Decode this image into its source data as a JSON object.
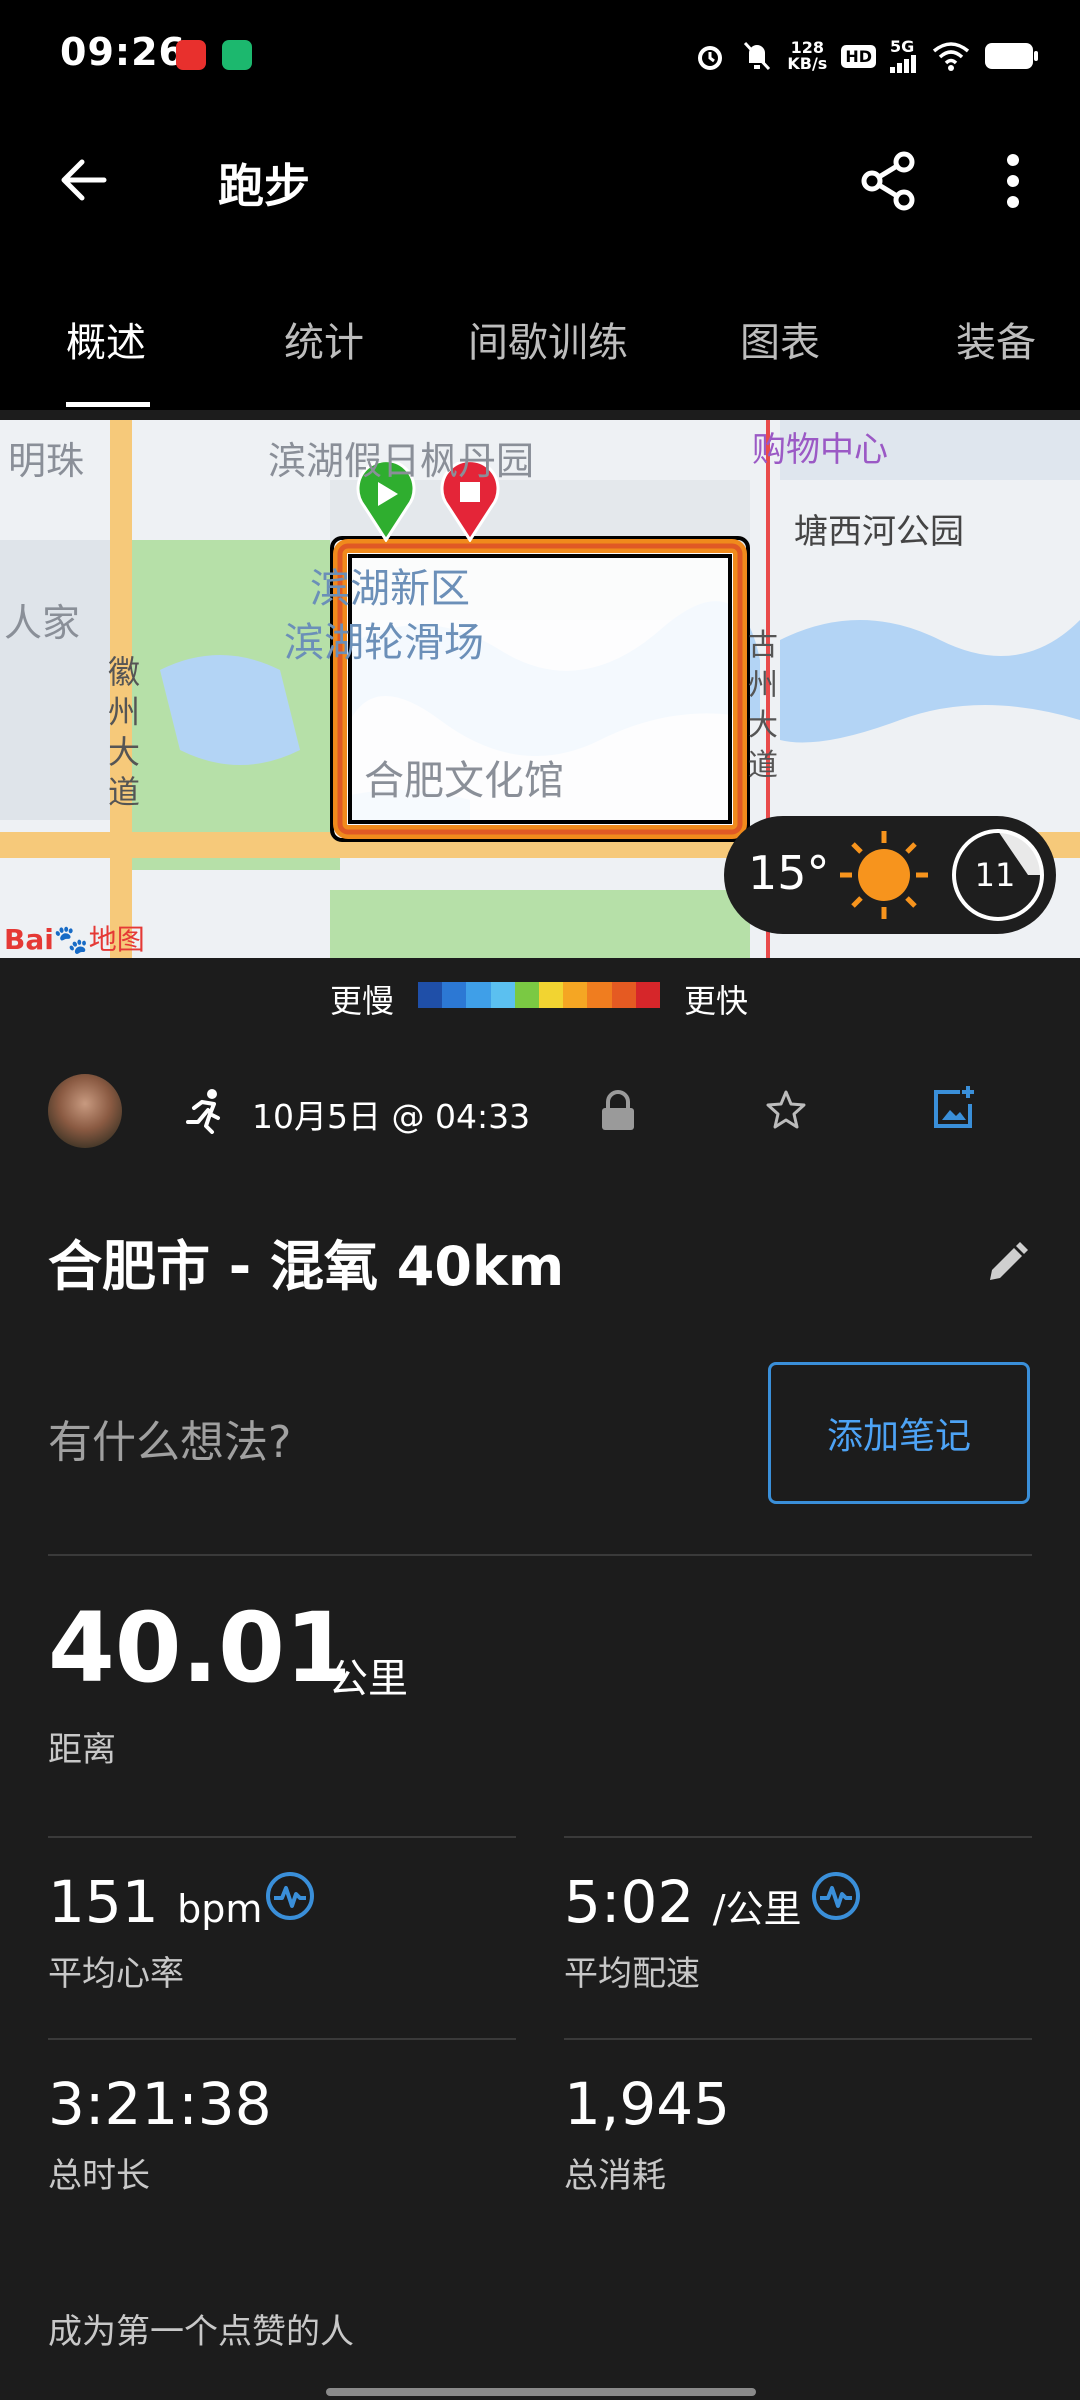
{
  "status_bar": {
    "time": "09:26",
    "net_speed_top": "128",
    "net_speed_bottom": "KB/s",
    "hd": "HD",
    "network": "5G"
  },
  "app_bar": {
    "title": "跑步",
    "back_icon": "arrow-left-icon",
    "share_icon": "share-icon",
    "more_icon": "more-vertical-icon"
  },
  "tabs": [
    {
      "label": "概述",
      "active": true
    },
    {
      "label": "统计",
      "active": false
    },
    {
      "label": "间歇训练",
      "active": false
    },
    {
      "label": "图表",
      "active": false
    },
    {
      "label": "装备",
      "active": false
    }
  ],
  "map": {
    "labels": {
      "mingzhu": "明珠",
      "binhu_jiari": "滨湖假日枫丹园",
      "gouwu": "购物中心",
      "tangxihe": "塘西河公园",
      "renjia": "人家",
      "binhu_xinqu": "滨湖新区",
      "binhu_lunhua": "滨湖轮滑场",
      "huizhou": "徽州大道",
      "wenhua": "合肥文化馆",
      "guzhou": "古州大道",
      "baidu": "Bai",
      "baidu_map": "地图"
    },
    "weather": {
      "temp": "15°",
      "wind": "11"
    },
    "colors": {
      "route_outer": "#f08a1c",
      "route_inner": "#d9442a",
      "water": "#b3d4f5",
      "green": "#b6e0a8"
    }
  },
  "legend": {
    "slow": "更慢",
    "fast": "更快",
    "colors": [
      "#1f4fa8",
      "#2c78d4",
      "#3f9fe8",
      "#5bc0f0",
      "#7ac943",
      "#f2d431",
      "#f5a623",
      "#f07d1f",
      "#e55a22",
      "#d6262a"
    ]
  },
  "activity": {
    "date": "10月5日 @ 04:33",
    "title": "合肥市 - 混氧 40km",
    "thought_placeholder": "有什么想法?",
    "add_note": "添加笔记"
  },
  "stats": {
    "distance": {
      "value": "40.01",
      "unit": "公里",
      "label": "距离"
    },
    "heart_rate": {
      "value": "151",
      "unit": "bpm",
      "label": "平均心率"
    },
    "pace": {
      "value": "5:02",
      "unit": "/公里",
      "label": "平均配速"
    },
    "duration": {
      "value": "3:21:38",
      "label": "总时长"
    },
    "calories": {
      "value": "1,945",
      "label": "总消耗"
    }
  },
  "footer": {
    "like_text": "成为第一个点赞的人"
  }
}
